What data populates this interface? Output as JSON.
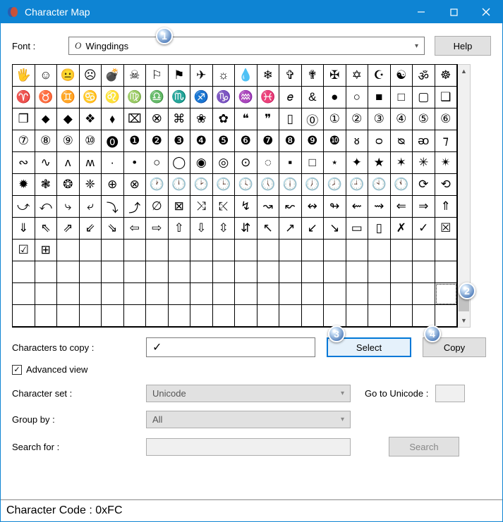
{
  "title": "Character Map",
  "font": {
    "label": "Font :",
    "value": "Wingdings"
  },
  "help": "Help",
  "grid": {
    "cols": 20,
    "rows": 12,
    "selected_index": 219,
    "chars": [
      "🖐",
      "☺",
      "😐",
      "☹",
      "💣",
      "☠",
      "⚐",
      "⚑",
      "✈",
      "☼",
      "💧",
      "❄",
      "✞",
      "✟",
      "✠",
      "✡",
      "☪",
      "☯",
      "ॐ",
      "☸",
      "♈",
      "♉",
      "♊",
      "♋",
      "♌",
      "♍",
      "♎",
      "♏",
      "♐",
      "♑",
      "♒",
      "♓",
      "𝑒",
      "&",
      "●",
      "○",
      "■",
      "□",
      "▢",
      "❑",
      "❒",
      "⬥",
      "◆",
      "❖",
      "⬧",
      "⌧",
      "⮿",
      "⌘",
      "❀",
      "✿",
      "❝",
      "❞",
      "▯",
      "⓪",
      "①",
      "②",
      "③",
      "④",
      "⑤",
      "⑥",
      "⑦",
      "⑧",
      "⑨",
      "⑩",
      "⓿",
      "❶",
      "❷",
      "❸",
      "❹",
      "❺",
      "❻",
      "❼",
      "❽",
      "❾",
      "❿",
      "ᴕ",
      "ᴑ",
      "ᴓ",
      "ᴔ",
      "⁊",
      "∾",
      "∿",
      "ʌ",
      "ʍ",
      "·",
      "•",
      "○",
      "◯",
      "◉",
      "◎",
      "⊙",
      "◌",
      "▪",
      "□",
      "⋆",
      "✦",
      "★",
      "✶",
      "✳",
      "✴",
      "✹",
      "❃",
      "❂",
      "❈",
      "⊕",
      "⊗",
      "🕐",
      "🕛",
      "🕑",
      "🕒",
      "🕓",
      "🕔",
      "🕕",
      "🕖",
      "🕗",
      "🕘",
      "🕙",
      "🕚",
      "⟳",
      "⟲",
      "⤻",
      "⤺",
      "⤷",
      "⤶",
      "⤵",
      "⤴",
      "∅",
      "⊠",
      "⤨",
      "⤪",
      "↯",
      "↝",
      "↜",
      "↭",
      "↬",
      "⇜",
      "⇝",
      "⇐",
      "⇒",
      "⇑",
      "⇓",
      "⇖",
      "⇗",
      "⇙",
      "⇘",
      "⇦",
      "⇨",
      "⇧",
      "⇩",
      "⇳",
      "⇵",
      "↖",
      "↗",
      "↙",
      "↘",
      "▭",
      "▯",
      "✗",
      "✓",
      "☒",
      "☑",
      "⊞",
      "",
      "",
      "",
      "",
      "",
      "",
      "",
      "",
      "",
      "",
      "",
      "",
      "",
      "",
      "",
      "",
      "",
      "",
      "",
      "",
      "",
      "",
      "",
      "",
      "",
      "",
      "",
      "",
      "",
      "",
      "",
      "",
      "",
      "",
      "",
      "",
      "",
      ""
    ]
  },
  "copy": {
    "label": "Characters to copy :",
    "value": "✓",
    "select": "Select",
    "copy": "Copy"
  },
  "advanced": {
    "label": "Advanced view",
    "checked": true
  },
  "charset": {
    "label": "Character set :",
    "value": "Unicode"
  },
  "goto": {
    "label": "Go to Unicode :",
    "value": ""
  },
  "groupby": {
    "label": "Group by :",
    "value": "All"
  },
  "search": {
    "label": "Search for :",
    "value": "",
    "button": "Search"
  },
  "status": "Character Code : 0xFC",
  "hotspots": {
    "h1": "1",
    "h2": "2",
    "h3": "3",
    "h4": "4"
  }
}
